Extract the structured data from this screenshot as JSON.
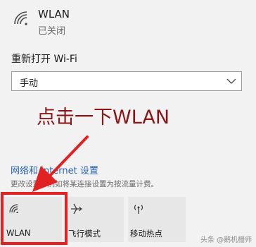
{
  "wlan": {
    "title": "WLAN",
    "status": "已关闭"
  },
  "reconnect": {
    "label": "重新打开 Wi-Fi",
    "value": "手动"
  },
  "annotation": "点击一下WLAN",
  "network_settings": {
    "link": "网络和 Internet 设置",
    "description": "更改设置，例如将某连接设置为按流量计费。"
  },
  "tiles": [
    {
      "label": "WLAN",
      "icon": "wifi-icon"
    },
    {
      "label": "飞行模式",
      "icon": "airplane-icon"
    },
    {
      "label": "移动热点",
      "icon": "hotspot-icon"
    }
  ],
  "watermark": "头条 @鹅机栅师",
  "colors": {
    "annotation": "#8a1616",
    "highlight": "#e02222",
    "link": "#2a63b0"
  }
}
